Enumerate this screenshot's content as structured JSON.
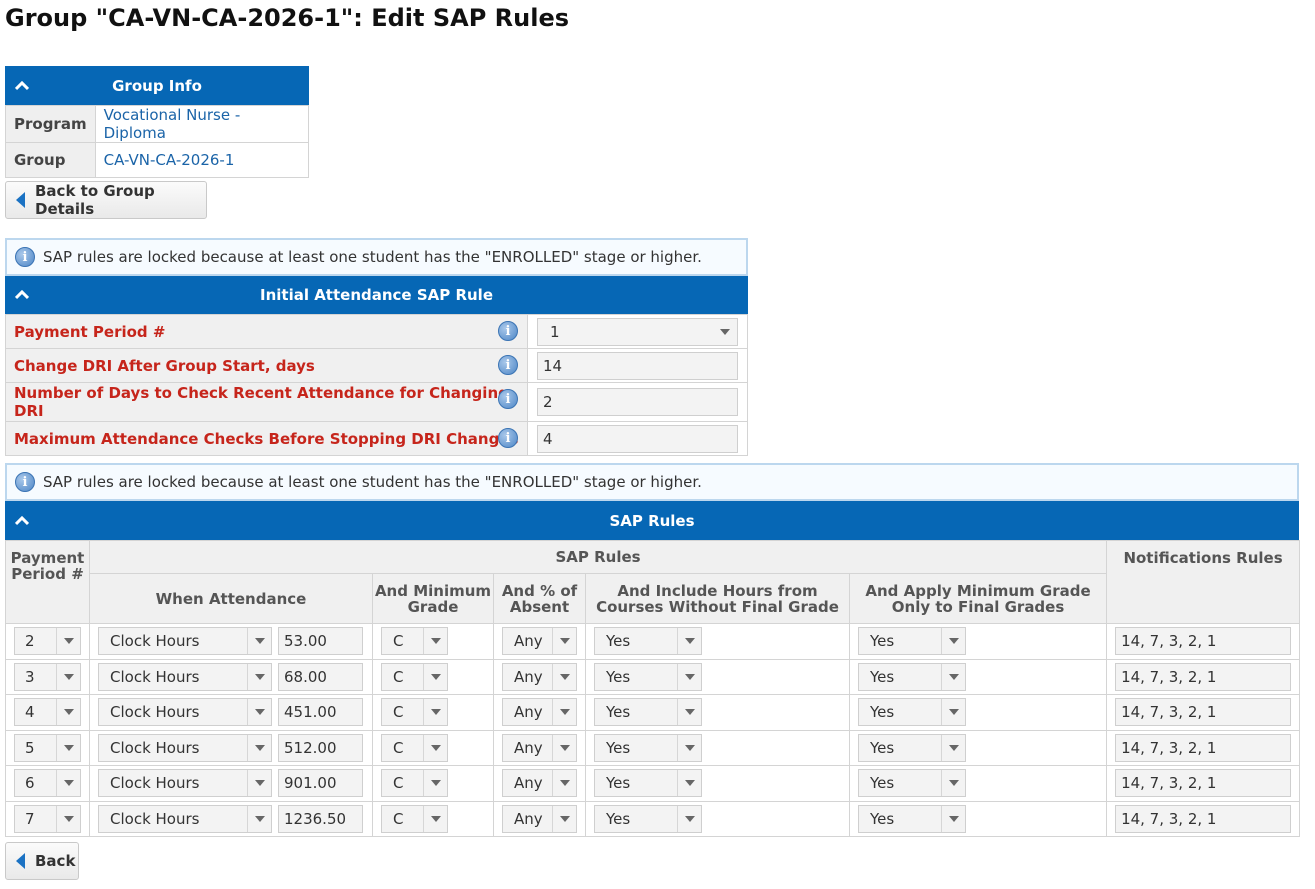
{
  "page": {
    "title": "Group \"CA-VN-CA-2026-1\": Edit SAP Rules"
  },
  "group_info": {
    "header": "Group Info",
    "rows": [
      {
        "label": "Program",
        "value": "Vocational Nurse - Diploma"
      },
      {
        "label": "Group",
        "value": "CA-VN-CA-2026-1"
      }
    ]
  },
  "back_to_group_button": "Back to Group Details",
  "lock_notice": "SAP rules are locked because at least one student has the \"ENROLLED\" stage or higher.",
  "initial_rule": {
    "header": "Initial Attendance SAP Rule",
    "rows": [
      {
        "label": "Payment Period #",
        "value": "1"
      },
      {
        "label": "Change DRI After Group Start, days",
        "value": "14"
      },
      {
        "label": "Number of Days to Check Recent Attendance for Changing DRI",
        "value": "2"
      },
      {
        "label": "Maximum Attendance Checks Before Stopping DRI Changes",
        "value": "4"
      }
    ]
  },
  "sap_rules": {
    "header": "SAP Rules",
    "columns": {
      "payment_period": "Payment Period #",
      "group": "SAP Rules",
      "when_attendance": "When Attendance",
      "min_grade": "And Minimum Grade",
      "pct_absent": "And % of Absent",
      "include_hours": "And Include Hours from Courses Without Final Grade",
      "apply_min": "And Apply Minimum Grade Only to Final Grades",
      "notifications": "Notifications Rules"
    },
    "rows": [
      {
        "period": "2",
        "attendance_type": "Clock Hours",
        "hours": "53.00",
        "grade": "C",
        "absent": "Any",
        "include": "Yes",
        "apply": "Yes",
        "notify": "14, 7, 3, 2, 1"
      },
      {
        "period": "3",
        "attendance_type": "Clock Hours",
        "hours": "68.00",
        "grade": "C",
        "absent": "Any",
        "include": "Yes",
        "apply": "Yes",
        "notify": "14, 7, 3, 2, 1"
      },
      {
        "period": "4",
        "attendance_type": "Clock Hours",
        "hours": "451.00",
        "grade": "C",
        "absent": "Any",
        "include": "Yes",
        "apply": "Yes",
        "notify": "14, 7, 3, 2, 1"
      },
      {
        "period": "5",
        "attendance_type": "Clock Hours",
        "hours": "512.00",
        "grade": "C",
        "absent": "Any",
        "include": "Yes",
        "apply": "Yes",
        "notify": "14, 7, 3, 2, 1"
      },
      {
        "period": "6",
        "attendance_type": "Clock Hours",
        "hours": "901.00",
        "grade": "C",
        "absent": "Any",
        "include": "Yes",
        "apply": "Yes",
        "notify": "14, 7, 3, 2, 1"
      },
      {
        "period": "7",
        "attendance_type": "Clock Hours",
        "hours": "1236.50",
        "grade": "C",
        "absent": "Any",
        "include": "Yes",
        "apply": "Yes",
        "notify": "14, 7, 3, 2, 1"
      }
    ]
  },
  "back_button": "Back",
  "colors": {
    "header_blue": "#0667b5",
    "required_red": "#c6251b",
    "link_blue": "#1b64a8"
  }
}
